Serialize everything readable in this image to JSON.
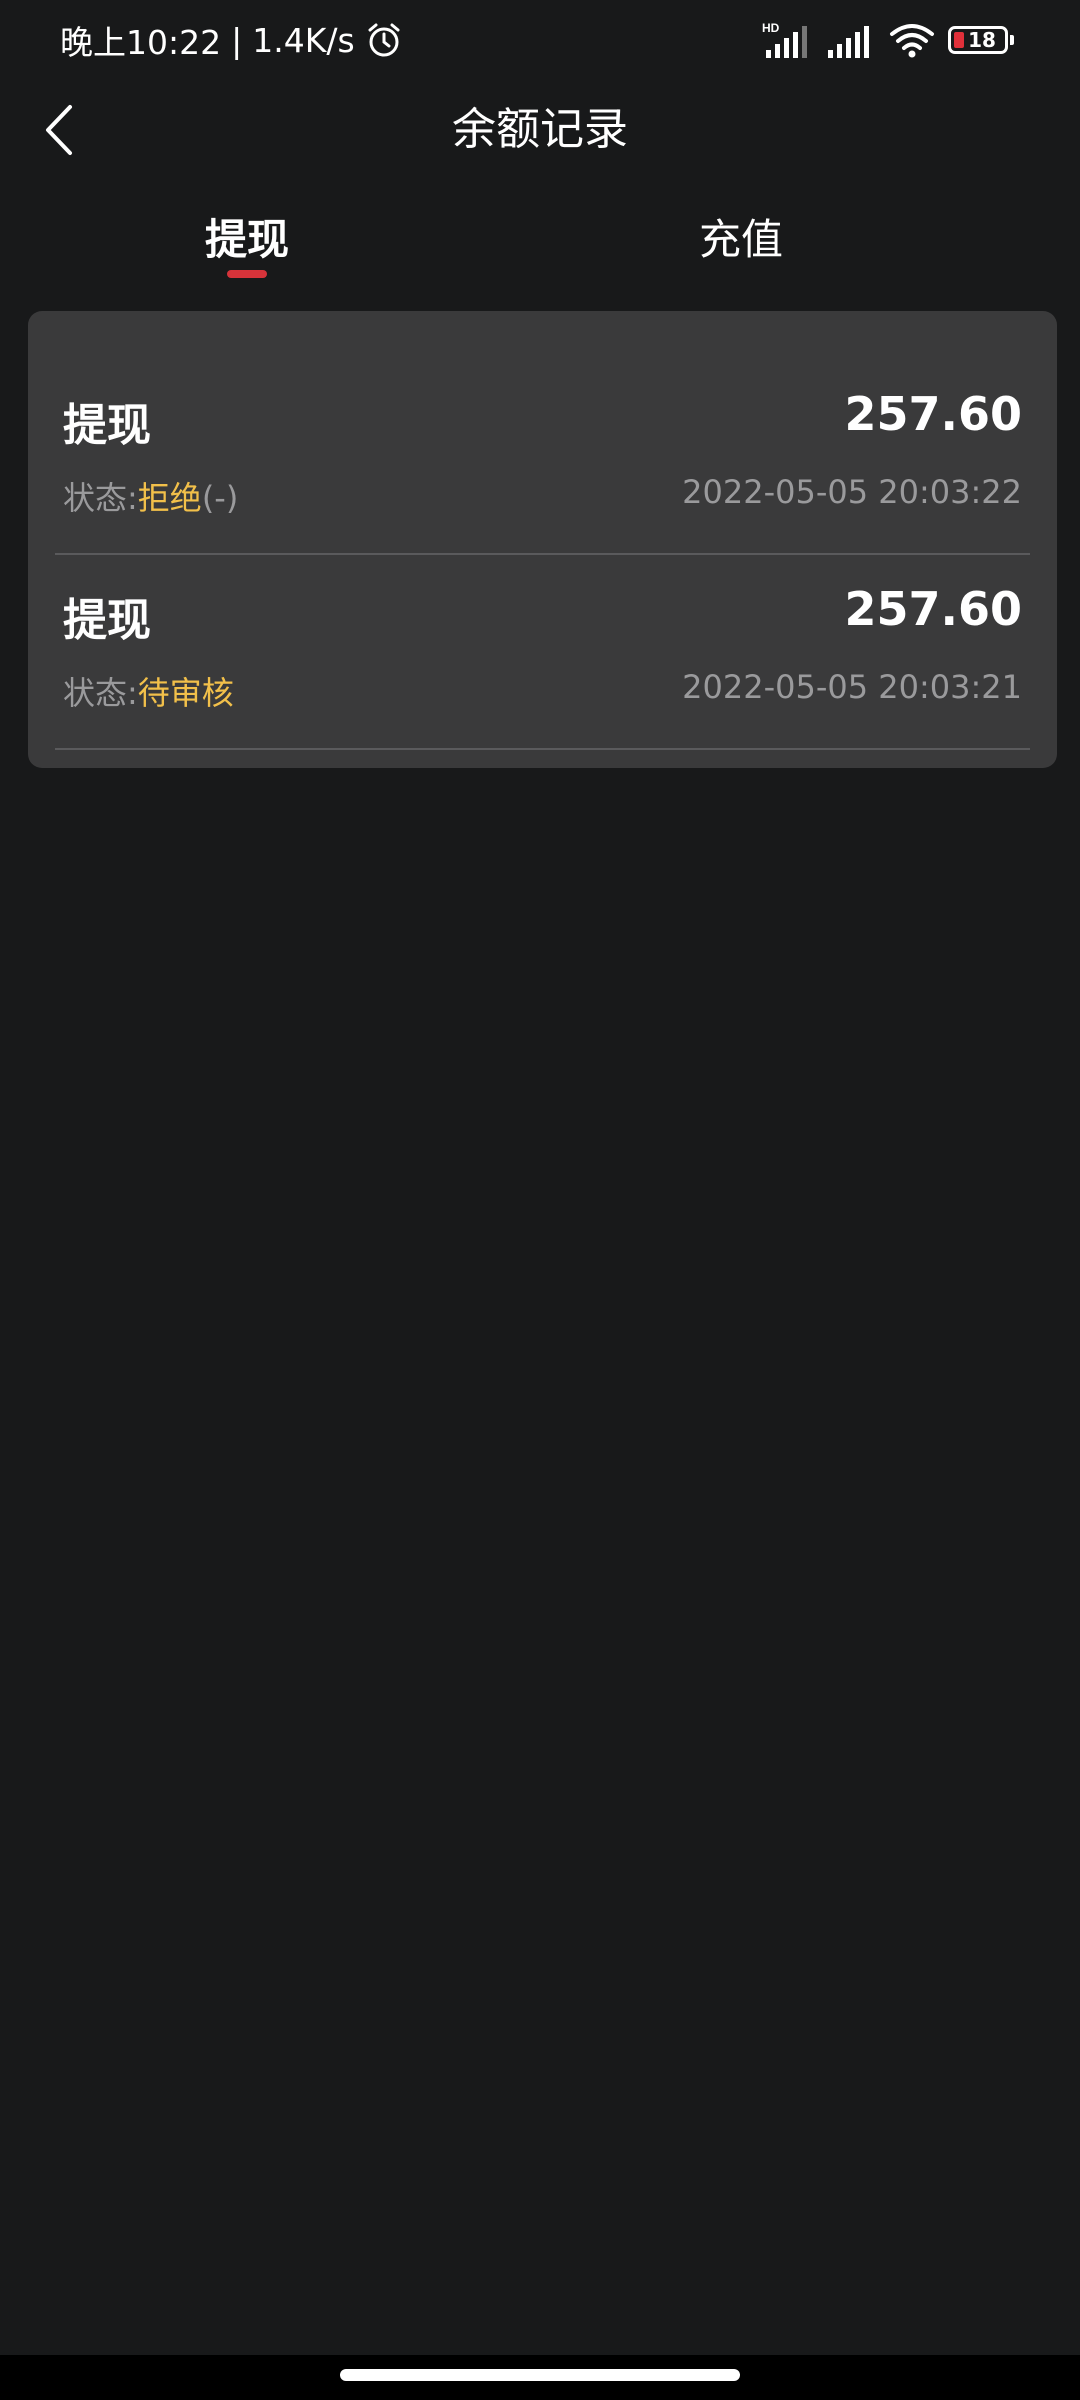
{
  "status_bar": {
    "time": "晚上10:22",
    "separator": "|",
    "speed": "1.4K/s",
    "hd_label": "HD",
    "battery": "18",
    "icons": [
      "alarm-icon",
      "signal-hd-icon",
      "signal-icon",
      "wifi-icon",
      "battery-icon"
    ]
  },
  "header": {
    "back_icon": "chevron-left-icon",
    "title": "余额记录"
  },
  "tabs": [
    {
      "label": "提现",
      "active": true
    },
    {
      "label": "充值",
      "active": false
    }
  ],
  "colors": {
    "background": "#18191a",
    "card": "#3a3a3b",
    "accent": "#d6333a",
    "status_highlight": "#f2c04a"
  },
  "records": [
    {
      "type": "提现",
      "amount": "257.60",
      "status_label": "状态:",
      "status_value": "拒绝",
      "status_suffix": "(-)",
      "time": "2022-05-05 20:03:22"
    },
    {
      "type": "提现",
      "amount": "257.60",
      "status_label": "状态:",
      "status_value": "待审核",
      "status_suffix": "",
      "time": "2022-05-05 20:03:21"
    }
  ]
}
